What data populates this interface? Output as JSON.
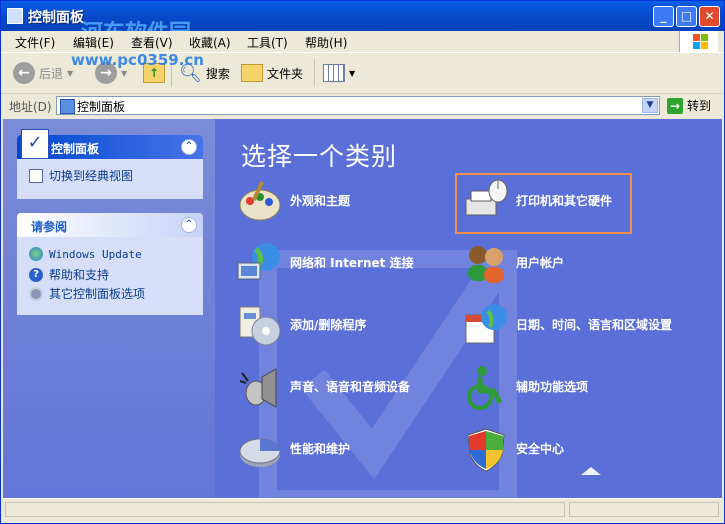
{
  "window": {
    "title": "控制面板"
  },
  "watermark": {
    "line1": "河东软件园",
    "line2": "www.pc0359.cn"
  },
  "menu": [
    "文件(F)",
    "编辑(E)",
    "查看(V)",
    "收藏(A)",
    "工具(T)",
    "帮助(H)"
  ],
  "toolbar": {
    "back": "后退",
    "search": "搜索",
    "folders": "文件夹"
  },
  "address": {
    "label": "地址(D)",
    "value": "控制面板",
    "go": "转到"
  },
  "left_panels": {
    "control_panel": {
      "title": "控制面板",
      "switch_view": "切换到经典视图"
    },
    "see_also": {
      "title": "请参阅",
      "items": [
        "Windows Update",
        "帮助和支持",
        "其它控制面板选项"
      ]
    }
  },
  "main": {
    "heading": "选择一个类别",
    "categories": [
      {
        "label": "外观和主题",
        "icon": "appearance-icon"
      },
      {
        "label": "打印机和其它硬件",
        "icon": "printer-icon"
      },
      {
        "label": "网络和 Internet 连接",
        "icon": "network-icon"
      },
      {
        "label": "用户帐户",
        "icon": "users-icon"
      },
      {
        "label": "添加/删除程序",
        "icon": "add-remove-icon"
      },
      {
        "label": "日期、时间、语言和区域设置",
        "icon": "date-time-icon"
      },
      {
        "label": "声音、语音和音频设备",
        "icon": "sound-icon"
      },
      {
        "label": "辅助功能选项",
        "icon": "accessibility-icon"
      },
      {
        "label": "性能和维护",
        "icon": "performance-icon"
      },
      {
        "label": "安全中心",
        "icon": "security-shield-icon"
      }
    ]
  },
  "colors": {
    "pane_bg": "#5a6fd8",
    "title_bar": "#0649c9",
    "highlight": "#f2904a"
  }
}
